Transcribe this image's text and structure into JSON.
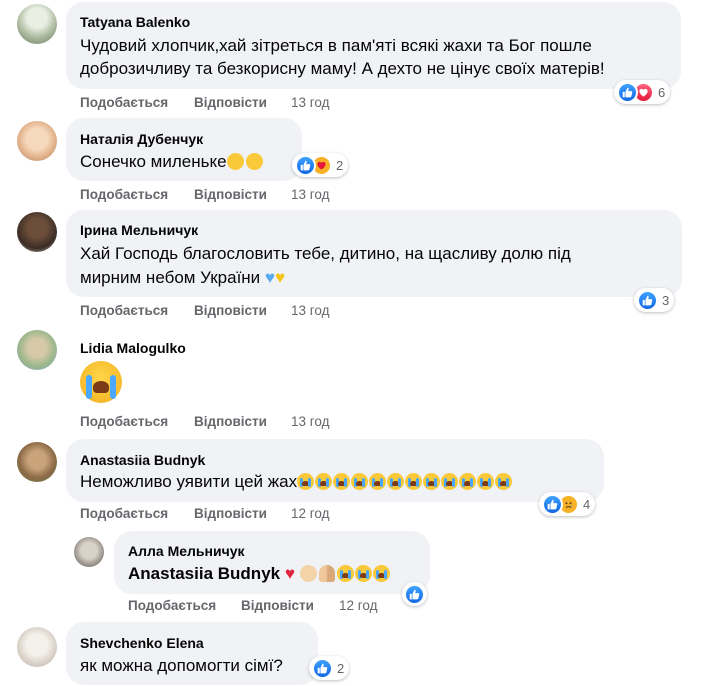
{
  "actions": {
    "like": "Подобається",
    "reply": "Відповісти"
  },
  "comments": [
    {
      "author": "Tatyana Balenko",
      "text_line1": "Чудовий хлопчик,хай зітреться в пам'яті всякі жахи та Бог пошле",
      "text_line2": "доброзичливу та безкорисну маму! А дехто не цінує своїх матерів!",
      "time": "13 год",
      "reactions": [
        "like",
        "love"
      ],
      "count": "6"
    },
    {
      "author": "Наталія Дубенчук",
      "text": "Сонечко миленьке",
      "time": "13 год",
      "reactions": [
        "like",
        "care"
      ],
      "count": "2"
    },
    {
      "author": "Ірина Мельничук",
      "text_line1": "Хай Господь благословить тебе, дитино, на щасливу долю під",
      "text_line2": "мирним небом України",
      "time": "13 год",
      "reactions": [
        "like"
      ],
      "count": "3"
    },
    {
      "author": "Lidia Malogulko",
      "time": "13 год"
    },
    {
      "author": "Anastasiia Budnyk",
      "text": "Неможливо уявити цей жах",
      "time": "12 год",
      "reactions": [
        "like",
        "sad"
      ],
      "count": "4"
    },
    {
      "author": "Алла Мельничук",
      "mention": "Anastasiia Budnyk",
      "time": "12 год",
      "reactions": [
        "like"
      ],
      "count": ""
    },
    {
      "author": "Shevchenko Elena",
      "text": "як можна допомогти сімї?",
      "time": "",
      "reactions": [
        "like"
      ],
      "count": "2"
    }
  ],
  "icons": {
    "like": "like-icon",
    "love": "love-icon",
    "care": "care-icon",
    "sad": "sad-icon",
    "cry": "loudly-crying-face-emoji"
  },
  "colors": {
    "bubble": "#f0f2f5",
    "meta": "#65676b",
    "like": "#1877f2"
  }
}
